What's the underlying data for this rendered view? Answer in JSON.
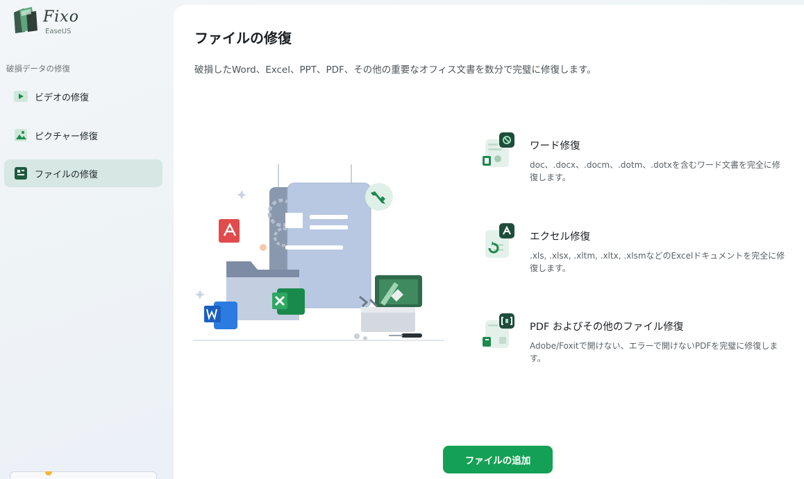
{
  "app": {
    "name": "Fixo",
    "vendor": "EaseUS"
  },
  "sidebar": {
    "section_label": "破損データの修復",
    "items": [
      {
        "label": "ビデオの修復",
        "icon": "video-play-icon",
        "active": false
      },
      {
        "label": "ピクチャー修復",
        "icon": "picture-icon",
        "active": false
      },
      {
        "label": "ファイルの修復",
        "icon": "file-doc-icon",
        "active": true
      }
    ]
  },
  "main": {
    "title": "ファイルの修復",
    "subtitle": "破損したWord、Excel、PPT、PDF、その他の重要なオフィス文書を数分で完璧に修復します。",
    "illustration": "file-repair-illustration",
    "features": [
      {
        "title": "ワード修復",
        "description": "doc、.docx、.docm、.dotm、.dotxを含むワード文書を完全に修復します。",
        "icon": "word-repair-icon"
      },
      {
        "title": "エクセル修復",
        "description": ".xls, .xlsx, .xltm, .xltx, .xlsmなどのExcelドキュメントを完全に修復します。",
        "icon": "excel-repair-icon"
      },
      {
        "title": "PDF およびその他のファイル修復",
        "description": "Adobe/Foxitで開けない、エラーで開けないPDFを完璧に修復します。",
        "icon": "pdf-repair-icon"
      }
    ],
    "add_button": "ファイルの追加"
  },
  "colors": {
    "accent": "#15a155",
    "active_nav_bg": "#d6e7e4",
    "icon_dark_green": "#1e4d3b"
  }
}
